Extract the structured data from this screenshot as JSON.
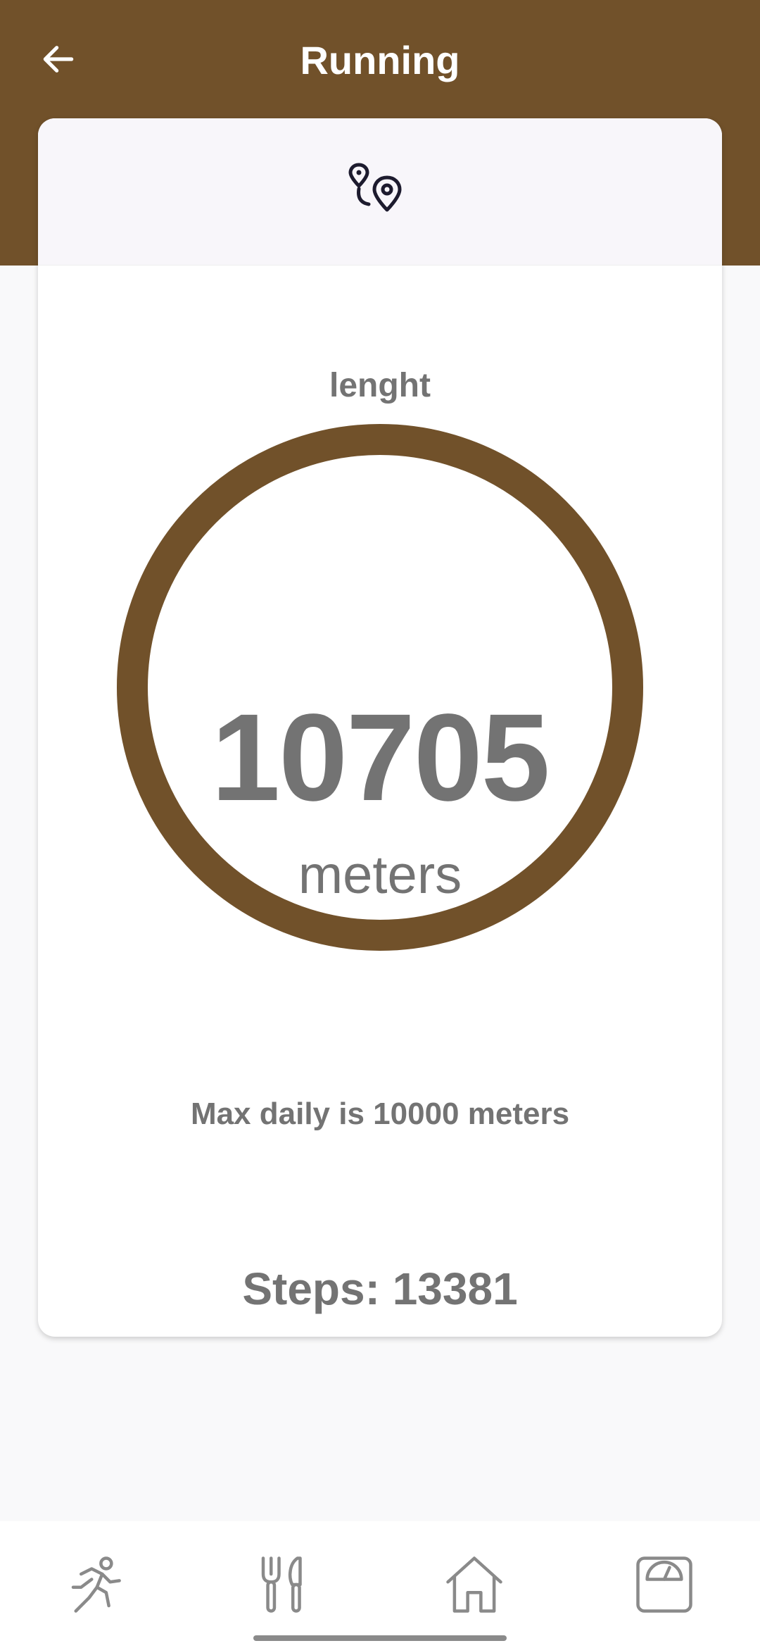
{
  "header": {
    "title": "Running",
    "back_icon": "arrow-left-icon",
    "background_color": "#71512a"
  },
  "card": {
    "top_icon": "route-pins-icon",
    "label": "lenght",
    "value": "10705",
    "unit": "meters",
    "progress_fraction": 1.0,
    "ring_color": "#71512a",
    "max_daily_text": "Max daily is 10000 meters",
    "steps_text": "Steps: 13381"
  },
  "bottom_nav": {
    "items": [
      {
        "icon": "running-icon"
      },
      {
        "icon": "fork-knife-icon"
      },
      {
        "icon": "home-icon"
      },
      {
        "icon": "scale-icon"
      }
    ],
    "icon_color": "#8a8a8a"
  }
}
